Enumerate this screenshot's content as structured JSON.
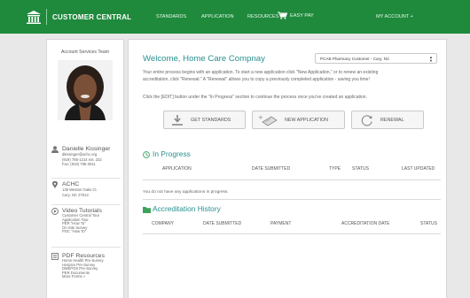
{
  "nav": {
    "brand": "CUSTOMER CENTRAL",
    "items": [
      "STANDARDS",
      "APPLICATION",
      "RESOURCES +",
      "EASY PAY",
      "MY ACCOUNT +"
    ]
  },
  "sidebar": {
    "team_title": "Account Services Team",
    "contact": {
      "name": "Danielle Kissinger",
      "email": "dkissinger@achc.org",
      "phone": "(919) 785-1214 ext. 232",
      "fax": "Fax: (919) 785-3011"
    },
    "org": {
      "name": "ACHC",
      "address1": "139 Weston Oaks Ct.",
      "address2": "Cary, NC 27513"
    },
    "videos": {
      "title": "Video Tutorials",
      "links": [
        "Customer Central Tour",
        "Application Tour",
        "PER \"How To\"",
        "On-Site Survey",
        "POC \"How To\""
      ]
    },
    "pdfs": {
      "title": "PDF Resources",
      "links": [
        "Home Health Pre-Survey",
        "Hospice Pre-Survey",
        "DMEPOS Pre-Survey",
        "PER Documents",
        "More Forms »"
      ]
    }
  },
  "main": {
    "welcome": "Welcome, Home Care Compnay",
    "select_value": "PCAB Pharmacy Customer - Cary, NC",
    "intro_line1": "Your entire process begins with an application. To start a new application click \"New Application,\" or to renew an existing",
    "intro_line2": "accreditation, click \"Renewal.\" A \"Renewal\" allows you to copy a previously completed application - saving you time!",
    "intro_line3": "Click the [EDIT] button under the \"In Progress\" section to continue the process once you've created an application.",
    "buttons": {
      "standards": "GET STANDARDS",
      "new_app": "NEW APPLICATION",
      "renewal": "RENEWAL"
    },
    "in_progress": {
      "title": "In Progress",
      "columns": [
        "APPLICATION",
        "DATE SUBMITTED",
        "TYPE",
        "STATUS",
        "LAST UPDATED"
      ],
      "empty": "You do not have any applications in progress."
    },
    "history": {
      "title": "Accreditation History",
      "columns": [
        "COMPANY",
        "DATE SUBMITTED",
        "PAYMENT",
        "ACCREDITATION DATE",
        "STATUS"
      ]
    }
  },
  "colors": {
    "brand_green": "#1f8a3c",
    "accent_teal": "#2a8f8f"
  }
}
